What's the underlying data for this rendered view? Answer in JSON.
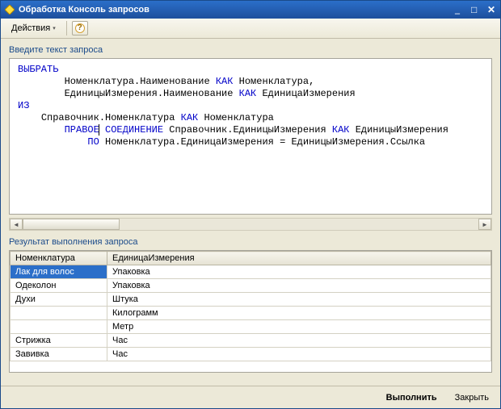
{
  "window": {
    "title": "Обработка  Консоль запросов"
  },
  "toolbar": {
    "actions_label": "Действия"
  },
  "section_query_label": "Введите текст запроса",
  "section_result_label": "Результат выполнения запроса",
  "query": {
    "lines": [
      {
        "indent": 0,
        "tokens": [
          {
            "t": "ВЫБРАТЬ",
            "kw": true
          }
        ]
      },
      {
        "indent": 2,
        "tokens": [
          {
            "t": "Номенклатура.Наименование "
          },
          {
            "t": "КАК",
            "kw": true
          },
          {
            "t": " Номенклатура,"
          }
        ]
      },
      {
        "indent": 2,
        "tokens": [
          {
            "t": "ЕдиницыИзмерения.Наименование "
          },
          {
            "t": "КАК",
            "kw": true
          },
          {
            "t": " ЕдиницаИзмерения"
          }
        ]
      },
      {
        "indent": 0,
        "tokens": [
          {
            "t": "ИЗ",
            "kw": true
          }
        ]
      },
      {
        "indent": 1,
        "tokens": [
          {
            "t": "Справочник.Номенклатура "
          },
          {
            "t": "КАК",
            "kw": true
          },
          {
            "t": " Номенклатура"
          }
        ]
      },
      {
        "indent": 2,
        "tokens": [
          {
            "t": "ПРАВОЕ",
            "kw": true,
            "caret_after": true
          },
          {
            "t": " "
          },
          {
            "t": "СОЕДИНЕНИЕ",
            "kw": true
          },
          {
            "t": " Справочник.ЕдиницыИзмерения "
          },
          {
            "t": "КАК",
            "kw": true
          },
          {
            "t": " ЕдиницыИзмерения"
          }
        ]
      },
      {
        "indent": 3,
        "tokens": [
          {
            "t": "ПО",
            "kw": true
          },
          {
            "t": " Номенклатура.ЕдиницаИзмерения = ЕдиницыИзмерения.Ссылка"
          }
        ]
      }
    ]
  },
  "result": {
    "columns": [
      "Номенклатура",
      "ЕдиницаИзмерения"
    ],
    "rows": [
      {
        "cells": [
          "Лак для волос",
          "Упаковка"
        ],
        "selected": true
      },
      {
        "cells": [
          "Одеколон",
          "Упаковка"
        ]
      },
      {
        "cells": [
          "Духи",
          "Штука"
        ]
      },
      {
        "cells": [
          "",
          "Килограмм"
        ]
      },
      {
        "cells": [
          "",
          "Метр"
        ]
      },
      {
        "cells": [
          "Стрижка",
          "Час"
        ]
      },
      {
        "cells": [
          "Завивка",
          "Час"
        ]
      }
    ]
  },
  "footer": {
    "execute": "Выполнить",
    "close": "Закрыть"
  }
}
